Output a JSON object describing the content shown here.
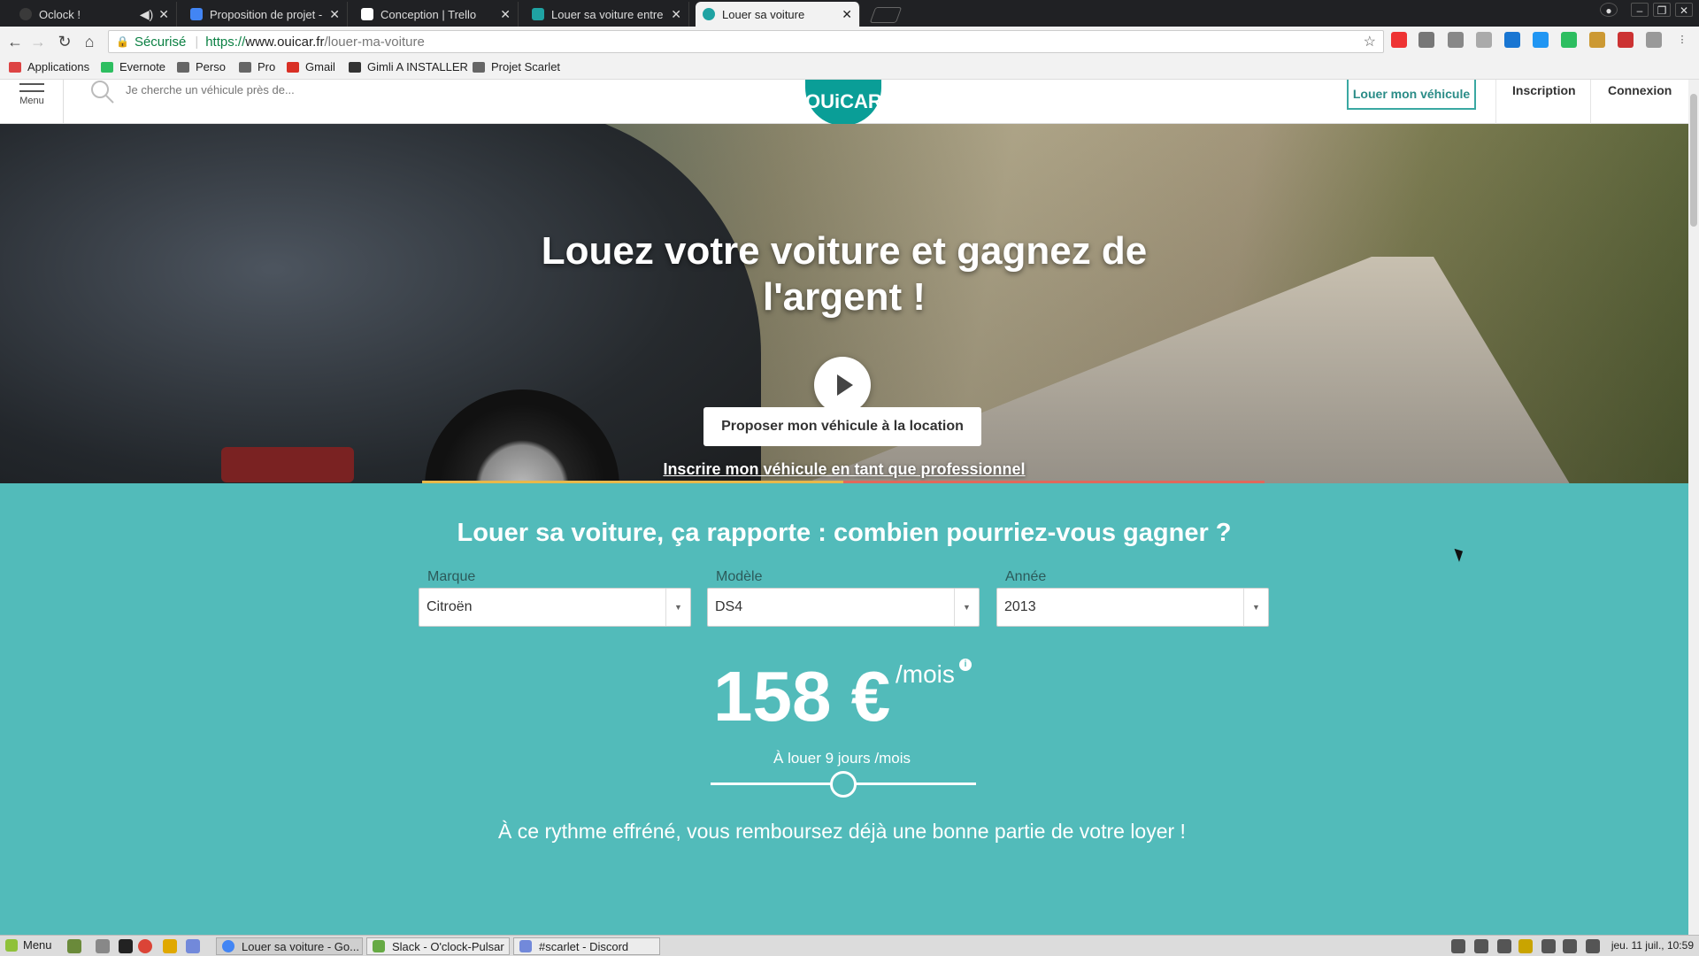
{
  "browser": {
    "tabs": [
      {
        "title": "Oclock !",
        "color": "#3a3a3a"
      },
      {
        "title": "Proposition de projet - G",
        "color": "#4285f4"
      },
      {
        "title": "Conception | Trello",
        "color": "#0079bf"
      },
      {
        "title": "Louer sa voiture entre p",
        "color": "#1fa3a3"
      },
      {
        "title": "Louer sa voiture",
        "color": "#1fa3a3"
      }
    ],
    "secure_label": "Sécurisé",
    "url_protocol": "https://",
    "url_host": "www.ouicar.fr",
    "url_path": "/louer-ma-voiture",
    "bookmarks": [
      {
        "label": "Applications",
        "color": "#d44"
      },
      {
        "label": "Evernote",
        "color": "#2dbe60"
      },
      {
        "label": "Perso",
        "color": "#666"
      },
      {
        "label": "Pro",
        "color": "#666"
      },
      {
        "label": "Gmail",
        "color": "#d93025"
      },
      {
        "label": "Gimli A INSTALLER",
        "color": "#333"
      },
      {
        "label": "Projet Scarlet",
        "color": "#666"
      }
    ]
  },
  "site": {
    "menu_label": "Menu",
    "search_placeholder": "Je cherche un véhicule près de...",
    "logo": "OUiCAR",
    "rent_button": "Louer mon véhicule",
    "signup": "Inscription",
    "login": "Connexion",
    "hero_title": "Louez votre voiture et gagnez de l'argent !",
    "propose_button": "Proposer mon véhicule à la location",
    "pro_link": "Inscrire mon véhicule en tant que professionnel",
    "calc_title": "Louer sa voiture, ça rapporte : combien pourriez-vous gagner ?",
    "fields": [
      {
        "label": "Marque",
        "value": "Citroën"
      },
      {
        "label": "Modèle",
        "value": "DS4"
      },
      {
        "label": "Année",
        "value": "2013"
      }
    ],
    "price": "158 €",
    "per_month": "/mois",
    "days_text": "À louer 9 jours /mois",
    "slider_level": 0.5,
    "rhythm_text": "À ce rythme effréné, vous remboursez déjà une bonne partie de votre loyer !",
    "accent_color": "#52bbba"
  },
  "taskbar": {
    "menu_label": "Menu",
    "windows": [
      {
        "label": "Louer sa voiture - Go...",
        "color": "#4285f4"
      },
      {
        "label": "Slack - O'clock-Pulsar",
        "color": "#6a4"
      },
      {
        "label": "#scarlet - Discord",
        "color": "#7289da"
      }
    ],
    "clock": "jeu. 11 juil., 10:59"
  }
}
